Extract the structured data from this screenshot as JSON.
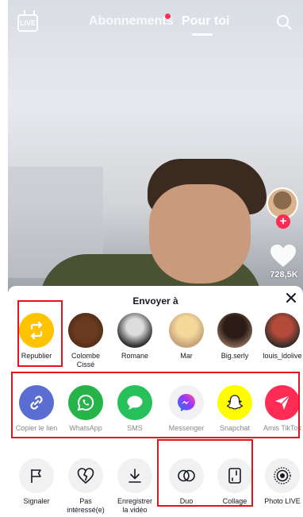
{
  "header": {
    "live_label": "LIVE",
    "tabs": [
      {
        "label": "Abonnements",
        "active": false,
        "has_dot": true
      },
      {
        "label": "Pour toi",
        "active": true
      }
    ]
  },
  "video": {
    "like_count": "728,5K"
  },
  "share_sheet": {
    "title": "Envoyer à",
    "contacts": [
      {
        "label": "Republier",
        "icon": "repost-icon"
      },
      {
        "label": "Colombe\nCissé",
        "icon": "avatar"
      },
      {
        "label": "Romane",
        "icon": "avatar"
      },
      {
        "label": "Mar",
        "icon": "avatar"
      },
      {
        "label": "Big.serly",
        "icon": "avatar"
      },
      {
        "label": "louis_ldolive",
        "icon": "avatar"
      }
    ],
    "apps": [
      {
        "label": "Copier le lien",
        "icon": "link-icon"
      },
      {
        "label": "WhatsApp",
        "icon": "whatsapp-icon"
      },
      {
        "label": "SMS",
        "icon": "sms-icon"
      },
      {
        "label": "Messenger",
        "icon": "messenger-icon"
      },
      {
        "label": "Snapchat",
        "icon": "snapchat-icon"
      },
      {
        "label": "Amis TikTok",
        "icon": "send-icon"
      }
    ],
    "actions": [
      {
        "label": "Signaler",
        "icon": "flag-icon"
      },
      {
        "label": "Pas\nintéressé(e)",
        "icon": "broken-heart-icon"
      },
      {
        "label": "Enregistrer\nla vidéo",
        "icon": "download-icon"
      },
      {
        "label": "Duo",
        "icon": "duet-icon"
      },
      {
        "label": "Collage",
        "icon": "stitch-icon"
      },
      {
        "label": "Photo LIVE",
        "icon": "live-photo-icon"
      }
    ]
  },
  "colors": {
    "accent": "#fe2c55",
    "highlight": "#e3121c",
    "repost": "#ffc300"
  }
}
